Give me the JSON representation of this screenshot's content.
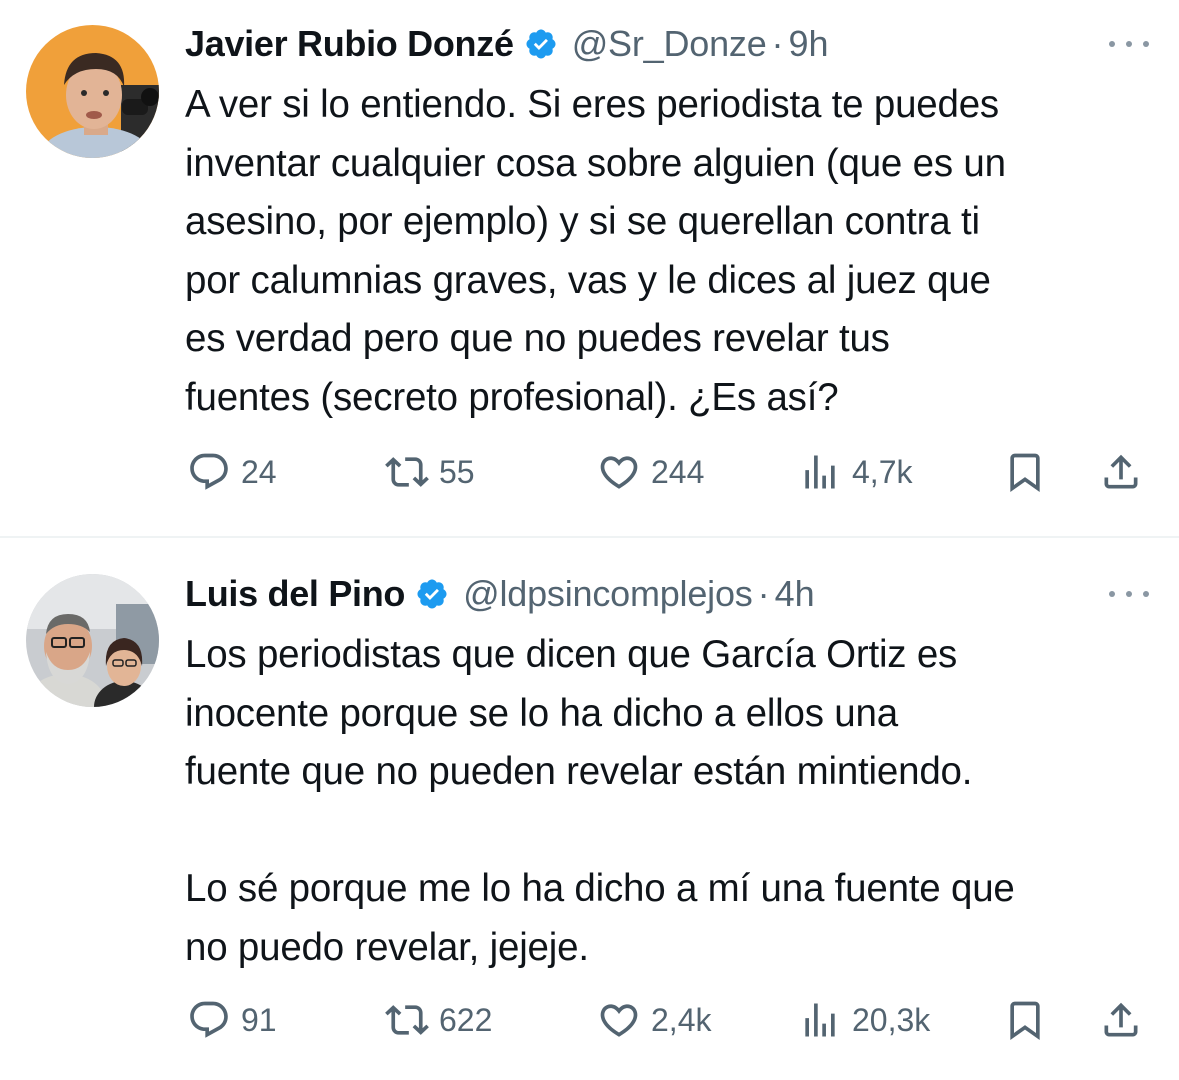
{
  "colors": {
    "text": "#0f1419",
    "secondary": "#536471",
    "verified": "#1d9bf0",
    "divider": "#eff3f4"
  },
  "tweets": [
    {
      "author": "Javier Rubio Donzé",
      "handle": "@Sr_Donze",
      "separator": "·",
      "time": "9h",
      "verified_icon": "verified-badge-icon",
      "lines": [
        "A ver si lo entiendo. Si eres periodista te puedes",
        "inventar cualquier cosa sobre alguien (que es un",
        "asesino, por ejemplo) y si se querellan contra ti",
        "por calumnias graves, vas y le dices al juez que",
        "es verdad pero que no puedes revelar tus",
        "fuentes (secreto profesional). ¿Es así?"
      ],
      "replies": "24",
      "reposts": "55",
      "likes": "244",
      "views": "4,7k"
    },
    {
      "author": "Luis del Pino",
      "handle": "@ldpsincomplejos",
      "separator": "·",
      "time": "4h",
      "verified_icon": "verified-badge-icon",
      "lines": [
        "Los periodistas que dicen que García Ortiz es",
        "inocente porque se lo ha dicho a ellos una",
        "fuente que no pueden revelar están mintiendo.",
        "",
        "Lo sé porque me lo ha dicho a mí una fuente que",
        "no puedo revelar, jejeje."
      ],
      "replies": "91",
      "reposts": "622",
      "likes": "2,4k",
      "views": "20,3k"
    }
  ]
}
